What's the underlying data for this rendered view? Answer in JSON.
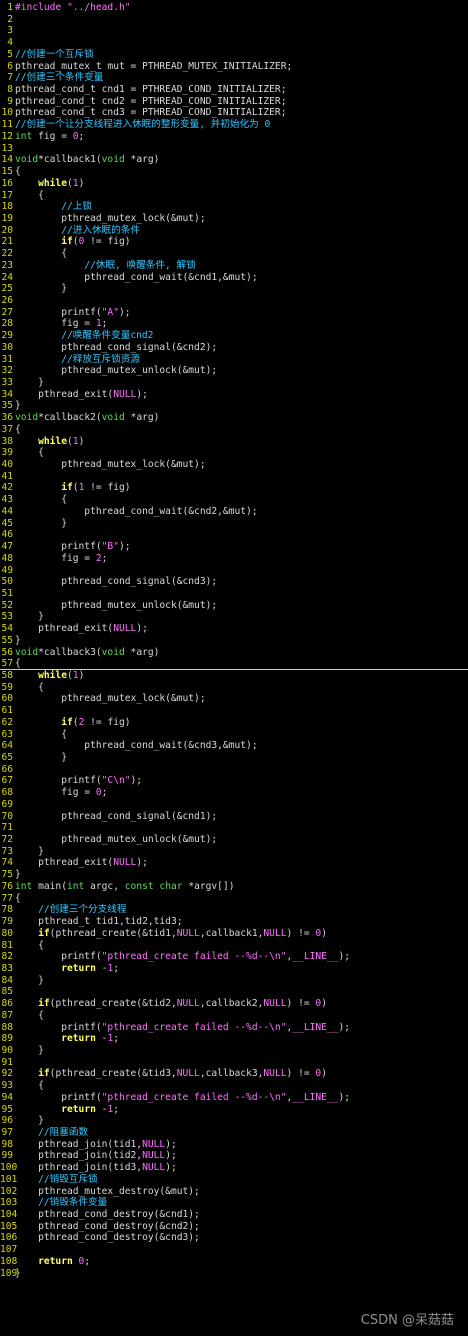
{
  "colors": {
    "background": "#000000",
    "line_number": "#d7d700",
    "keyword": "#ffff5f",
    "type": "#5fd75f",
    "comment": "#2fc7ff",
    "string": "#ff6fff",
    "number": "#ff6fff",
    "preprocessor": "#ff6fff",
    "text": "#d8d8d8"
  },
  "cursor_line": 57,
  "lines": [
    [
      [
        "pp",
        "#include "
      ],
      [
        "str",
        "\"../head.h\""
      ]
    ],
    [],
    [],
    [],
    [
      [
        "cm",
        "//创建一个互斥锁"
      ]
    ],
    [
      [
        "plain",
        "pthread_mutex_t mut = PTHREAD_MUTEX_INITIALIZER;"
      ]
    ],
    [
      [
        "cm",
        "//创建三个条件变量"
      ]
    ],
    [
      [
        "plain",
        "pthread_cond_t cnd1 = PTHREAD_COND_INITIALIZER;"
      ]
    ],
    [
      [
        "plain",
        "pthread_cond_t cnd2 = PTHREAD_COND_INITIALIZER;"
      ]
    ],
    [
      [
        "plain",
        "pthread_cond_t cnd3 = PTHREAD_COND_INITIALIZER;"
      ]
    ],
    [
      [
        "cm",
        "//创建一个让分支线程进入休眠的整形变量, 并初始化为 0"
      ]
    ],
    [
      [
        "ty",
        "int"
      ],
      [
        "plain",
        " fig = "
      ],
      [
        "num",
        "0"
      ],
      [
        "plain",
        ";"
      ]
    ],
    [],
    [
      [
        "ty",
        "void"
      ],
      [
        "plain",
        "*callback1("
      ],
      [
        "ty",
        "void"
      ],
      [
        "plain",
        " *arg)"
      ]
    ],
    [
      [
        "plain",
        "{"
      ]
    ],
    [
      [
        "plain",
        "    "
      ],
      [
        "kw",
        "while"
      ],
      [
        "plain",
        "("
      ],
      [
        "num",
        "1"
      ],
      [
        "plain",
        ")"
      ]
    ],
    [
      [
        "plain",
        "    {"
      ]
    ],
    [
      [
        "plain",
        "        "
      ],
      [
        "cm",
        "//上锁"
      ]
    ],
    [
      [
        "plain",
        "        pthread_mutex_lock(&mut);"
      ]
    ],
    [
      [
        "plain",
        "        "
      ],
      [
        "cm",
        "//进入休眠的条件"
      ]
    ],
    [
      [
        "plain",
        "        "
      ],
      [
        "kw",
        "if"
      ],
      [
        "plain",
        "("
      ],
      [
        "num",
        "0"
      ],
      [
        "plain",
        " != fig)"
      ]
    ],
    [
      [
        "plain",
        "        {"
      ]
    ],
    [
      [
        "plain",
        "            "
      ],
      [
        "cm",
        "//休眠, 唤醒条件, 解锁"
      ]
    ],
    [
      [
        "plain",
        "            pthread_cond_wait(&cnd1,&mut);"
      ]
    ],
    [
      [
        "plain",
        "        }"
      ]
    ],
    [],
    [
      [
        "plain",
        "        printf("
      ],
      [
        "str",
        "\"A\""
      ],
      [
        "plain",
        ");"
      ]
    ],
    [
      [
        "plain",
        "        fig = "
      ],
      [
        "num",
        "1"
      ],
      [
        "plain",
        ";"
      ]
    ],
    [
      [
        "plain",
        "        "
      ],
      [
        "cm",
        "//唤醒条件变量cnd2"
      ]
    ],
    [
      [
        "plain",
        "        pthread_cond_signal(&cnd2);"
      ]
    ],
    [
      [
        "plain",
        "        "
      ],
      [
        "cm",
        "//释放互斥锁资源"
      ]
    ],
    [
      [
        "plain",
        "        pthread_mutex_unlock(&mut);"
      ]
    ],
    [
      [
        "plain",
        "    }"
      ]
    ],
    [
      [
        "plain",
        "    pthread_exit("
      ],
      [
        "pp",
        "NULL"
      ],
      [
        "plain",
        ");"
      ]
    ],
    [
      [
        "plain",
        "}"
      ]
    ],
    [
      [
        "ty",
        "void"
      ],
      [
        "plain",
        "*callback2("
      ],
      [
        "ty",
        "void"
      ],
      [
        "plain",
        " *arg)"
      ]
    ],
    [
      [
        "plain",
        "{"
      ]
    ],
    [
      [
        "plain",
        "    "
      ],
      [
        "kw",
        "while"
      ],
      [
        "plain",
        "("
      ],
      [
        "num",
        "1"
      ],
      [
        "plain",
        ")"
      ]
    ],
    [
      [
        "plain",
        "    {"
      ]
    ],
    [
      [
        "plain",
        "        pthread_mutex_lock(&mut);"
      ]
    ],
    [],
    [
      [
        "plain",
        "        "
      ],
      [
        "kw",
        "if"
      ],
      [
        "plain",
        "("
      ],
      [
        "num",
        "1"
      ],
      [
        "plain",
        " != fig)"
      ]
    ],
    [
      [
        "plain",
        "        {"
      ]
    ],
    [
      [
        "plain",
        "            pthread_cond_wait(&cnd2,&mut);"
      ]
    ],
    [
      [
        "plain",
        "        }"
      ]
    ],
    [],
    [
      [
        "plain",
        "        printf("
      ],
      [
        "str",
        "\"B\""
      ],
      [
        "plain",
        ");"
      ]
    ],
    [
      [
        "plain",
        "        fig = "
      ],
      [
        "num",
        "2"
      ],
      [
        "plain",
        ";"
      ]
    ],
    [],
    [
      [
        "plain",
        "        pthread_cond_signal(&cnd3);"
      ]
    ],
    [],
    [
      [
        "plain",
        "        pthread_mutex_unlock(&mut);"
      ]
    ],
    [
      [
        "plain",
        "    }"
      ]
    ],
    [
      [
        "plain",
        "    pthread_exit("
      ],
      [
        "pp",
        "NULL"
      ],
      [
        "plain",
        ");"
      ]
    ],
    [
      [
        "plain",
        "}"
      ]
    ],
    [
      [
        "ty",
        "void"
      ],
      [
        "plain",
        "*callback3("
      ],
      [
        "ty",
        "void"
      ],
      [
        "plain",
        " *arg)"
      ]
    ],
    [
      [
        "plain",
        "{"
      ]
    ],
    [
      [
        "plain",
        "    "
      ],
      [
        "kw",
        "while"
      ],
      [
        "plain",
        "("
      ],
      [
        "num",
        "1"
      ],
      [
        "plain",
        ")"
      ]
    ],
    [
      [
        "plain",
        "    {"
      ]
    ],
    [
      [
        "plain",
        "        pthread_mutex_lock(&mut);"
      ]
    ],
    [],
    [
      [
        "plain",
        "        "
      ],
      [
        "kw",
        "if"
      ],
      [
        "plain",
        "("
      ],
      [
        "num",
        "2"
      ],
      [
        "plain",
        " != fig)"
      ]
    ],
    [
      [
        "plain",
        "        {"
      ]
    ],
    [
      [
        "plain",
        "            pthread_cond_wait(&cnd3,&mut);"
      ]
    ],
    [
      [
        "plain",
        "        }"
      ]
    ],
    [],
    [
      [
        "plain",
        "        printf("
      ],
      [
        "str",
        "\"C\\n\""
      ],
      [
        "plain",
        ");"
      ]
    ],
    [
      [
        "plain",
        "        fig = "
      ],
      [
        "num",
        "0"
      ],
      [
        "plain",
        ";"
      ]
    ],
    [],
    [
      [
        "plain",
        "        pthread_cond_signal(&cnd1);"
      ]
    ],
    [],
    [
      [
        "plain",
        "        pthread_mutex_unlock(&mut);"
      ]
    ],
    [
      [
        "plain",
        "    }"
      ]
    ],
    [
      [
        "plain",
        "    pthread_exit("
      ],
      [
        "pp",
        "NULL"
      ],
      [
        "plain",
        ");"
      ]
    ],
    [
      [
        "plain",
        "}"
      ]
    ],
    [
      [
        "ty",
        "int"
      ],
      [
        "plain",
        " main("
      ],
      [
        "ty",
        "int"
      ],
      [
        "plain",
        " argc, "
      ],
      [
        "ty",
        "const"
      ],
      [
        "plain",
        " "
      ],
      [
        "ty",
        "char"
      ],
      [
        "plain",
        " *argv[])"
      ]
    ],
    [
      [
        "plain",
        "{"
      ]
    ],
    [
      [
        "plain",
        "    "
      ],
      [
        "cm",
        "//创建三个分支线程"
      ]
    ],
    [
      [
        "plain",
        "    pthread_t tid1,tid2,tid3;"
      ]
    ],
    [
      [
        "plain",
        "    "
      ],
      [
        "kw",
        "if"
      ],
      [
        "plain",
        "(pthread_create(&tid1,"
      ],
      [
        "pp",
        "NULL"
      ],
      [
        "plain",
        ",callback1,"
      ],
      [
        "pp",
        "NULL"
      ],
      [
        "plain",
        ") != "
      ],
      [
        "num",
        "0"
      ],
      [
        "plain",
        ")"
      ]
    ],
    [
      [
        "plain",
        "    {"
      ]
    ],
    [
      [
        "plain",
        "        printf("
      ],
      [
        "str",
        "\"pthread_create failed --%d--\\n\""
      ],
      [
        "plain",
        ","
      ],
      [
        "pp",
        "__LINE__"
      ],
      [
        "plain",
        ");"
      ]
    ],
    [
      [
        "plain",
        "        "
      ],
      [
        "kw",
        "return"
      ],
      [
        "plain",
        " -"
      ],
      [
        "num",
        "1"
      ],
      [
        "plain",
        ";"
      ]
    ],
    [
      [
        "plain",
        "    }"
      ]
    ],
    [],
    [
      [
        "plain",
        "    "
      ],
      [
        "kw",
        "if"
      ],
      [
        "plain",
        "(pthread_create(&tid2,"
      ],
      [
        "pp",
        "NULL"
      ],
      [
        "plain",
        ",callback2,"
      ],
      [
        "pp",
        "NULL"
      ],
      [
        "plain",
        ") != "
      ],
      [
        "num",
        "0"
      ],
      [
        "plain",
        ")"
      ]
    ],
    [
      [
        "plain",
        "    {"
      ]
    ],
    [
      [
        "plain",
        "        printf("
      ],
      [
        "str",
        "\"pthread_create failed --%d--\\n\""
      ],
      [
        "plain",
        ","
      ],
      [
        "pp",
        "__LINE__"
      ],
      [
        "plain",
        ");"
      ]
    ],
    [
      [
        "plain",
        "        "
      ],
      [
        "kw",
        "return"
      ],
      [
        "plain",
        " -"
      ],
      [
        "num",
        "1"
      ],
      [
        "plain",
        ";"
      ]
    ],
    [
      [
        "plain",
        "    }"
      ]
    ],
    [],
    [
      [
        "plain",
        "    "
      ],
      [
        "kw",
        "if"
      ],
      [
        "plain",
        "(pthread_create(&tid3,"
      ],
      [
        "pp",
        "NULL"
      ],
      [
        "plain",
        ",callback3,"
      ],
      [
        "pp",
        "NULL"
      ],
      [
        "plain",
        ") != "
      ],
      [
        "num",
        "0"
      ],
      [
        "plain",
        ")"
      ]
    ],
    [
      [
        "plain",
        "    {"
      ]
    ],
    [
      [
        "plain",
        "        printf("
      ],
      [
        "str",
        "\"pthread_create failed --%d--\\n\""
      ],
      [
        "plain",
        ","
      ],
      [
        "pp",
        "__LINE__"
      ],
      [
        "plain",
        ");"
      ]
    ],
    [
      [
        "plain",
        "        "
      ],
      [
        "kw",
        "return"
      ],
      [
        "plain",
        " -"
      ],
      [
        "num",
        "1"
      ],
      [
        "plain",
        ";"
      ]
    ],
    [
      [
        "plain",
        "    }"
      ]
    ],
    [
      [
        "plain",
        "    "
      ],
      [
        "cm",
        "//阻塞函数"
      ]
    ],
    [
      [
        "plain",
        "    pthread_join(tid1,"
      ],
      [
        "pp",
        "NULL"
      ],
      [
        "plain",
        ");"
      ]
    ],
    [
      [
        "plain",
        "    pthread_join(tid2,"
      ],
      [
        "pp",
        "NULL"
      ],
      [
        "plain",
        ");"
      ]
    ],
    [
      [
        "plain",
        "    pthread_join(tid3,"
      ],
      [
        "pp",
        "NULL"
      ],
      [
        "plain",
        ");"
      ]
    ],
    [
      [
        "plain",
        "    "
      ],
      [
        "cm",
        "//销毁互斥锁"
      ]
    ],
    [
      [
        "plain",
        "    pthread_mutex_destroy(&mut);"
      ]
    ],
    [
      [
        "plain",
        "    "
      ],
      [
        "cm",
        "//销毁条件变量"
      ]
    ],
    [
      [
        "plain",
        "    pthread_cond_destroy(&cnd1);"
      ]
    ],
    [
      [
        "plain",
        "    pthread_cond_destroy(&cnd2);"
      ]
    ],
    [
      [
        "plain",
        "    pthread_cond_destroy(&cnd3);"
      ]
    ],
    [],
    [
      [
        "plain",
        "    "
      ],
      [
        "kw",
        "return"
      ],
      [
        "plain",
        " "
      ],
      [
        "num",
        "0"
      ],
      [
        "plain",
        ";"
      ]
    ],
    [
      [
        "plain",
        "}"
      ]
    ]
  ],
  "watermark": "CSDN @呆菇菇"
}
